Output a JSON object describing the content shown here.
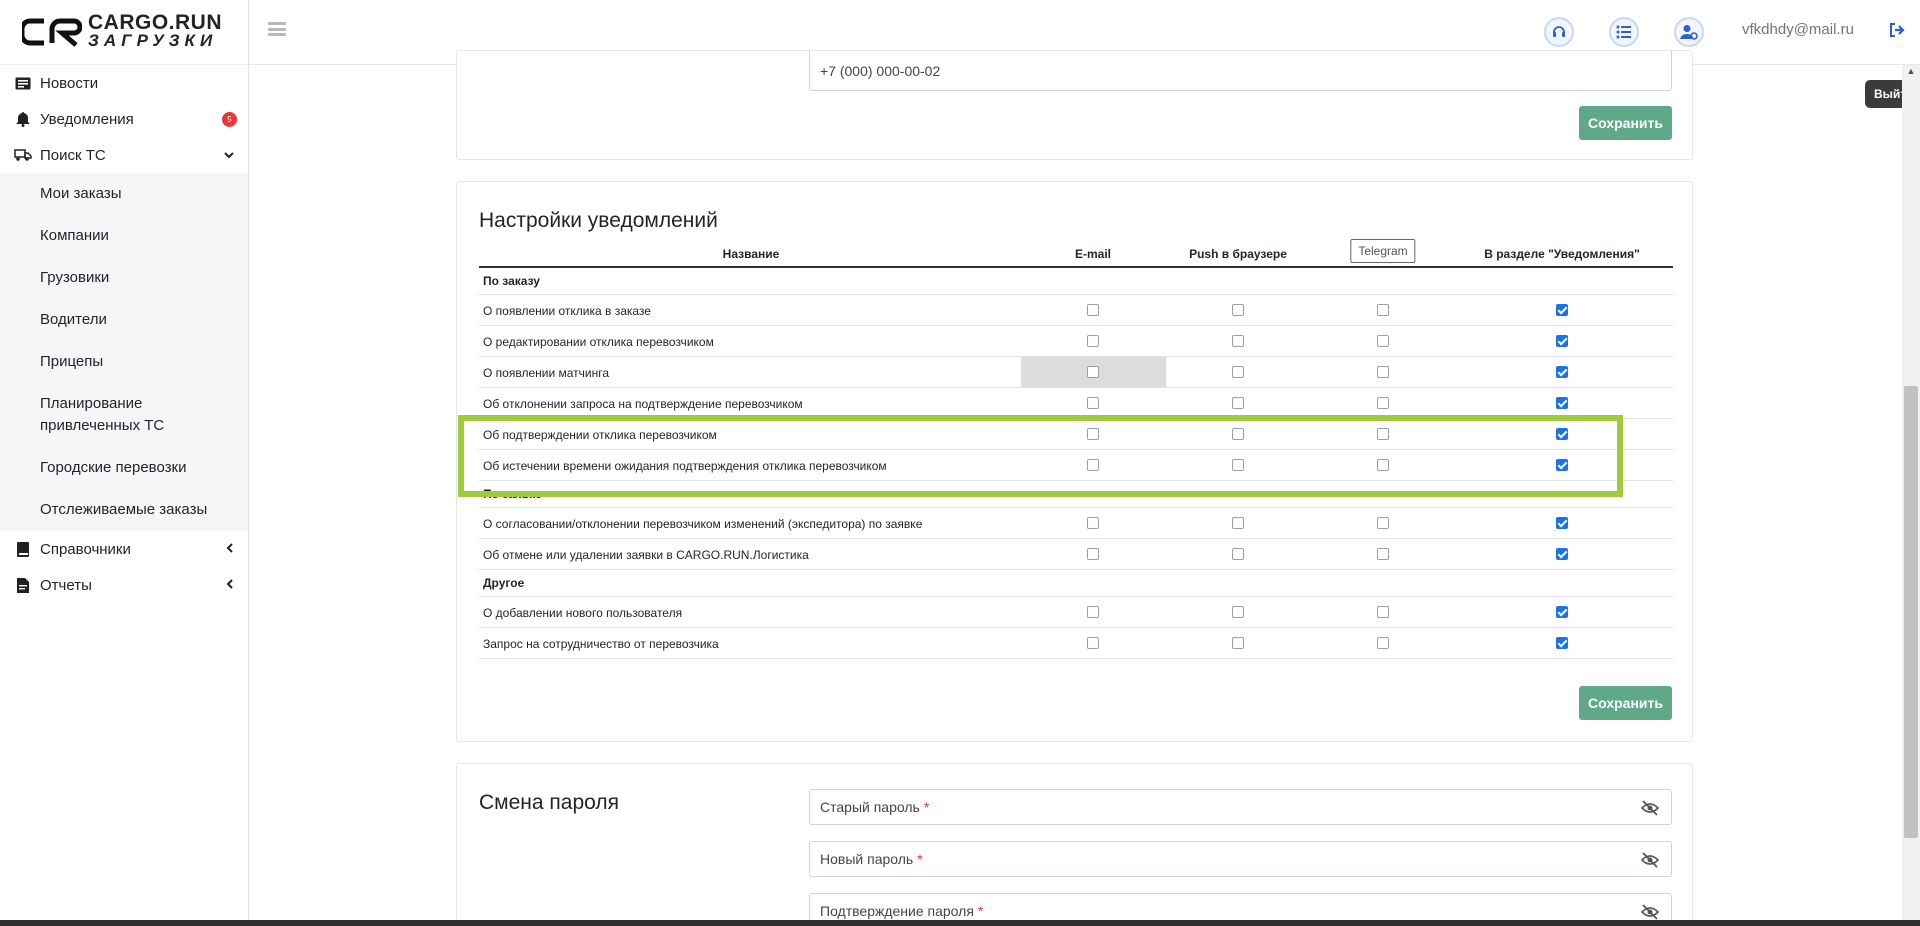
{
  "brand": {
    "line1": "CARGO.RUN",
    "line2": "ЗАГРУЗКИ"
  },
  "sidebar": {
    "items": [
      {
        "label": "Новости",
        "icon": "newspaper-icon"
      },
      {
        "label": "Уведомления",
        "icon": "bell-icon",
        "badge": "5"
      },
      {
        "label": "Поиск ТС",
        "icon": "truck-search-icon",
        "expanded": true
      }
    ],
    "subitems": [
      "Мои заказы",
      "Компании",
      "Грузовики",
      "Водители",
      "Прицепы",
      "Планирование привлеченных ТС",
      "Городские перевозки",
      "Отслеживаемые заказы"
    ],
    "bottom_items": [
      {
        "label": "Справочники",
        "icon": "book-icon"
      },
      {
        "label": "Отчеты",
        "icon": "report-icon"
      }
    ]
  },
  "header": {
    "user_email": "vfkdhdy@mail.ru",
    "icons": [
      "headset-icon",
      "list-icon",
      "user-settings-icon",
      "logout-icon"
    ],
    "tooltip": "Выйти"
  },
  "contact": {
    "phone_value": "+7 (000) 000-00-02",
    "save_label": "Сохранить"
  },
  "notifications": {
    "title": "Настройки уведомлений",
    "columns": {
      "name": "Название",
      "email": "E-mail",
      "push": "Push в браузере",
      "telegram": "Telegram",
      "section": "В разделе \"Уведомления\""
    },
    "groups": [
      {
        "title": "По заказу",
        "rows": [
          {
            "name": "О появлении отклика в заказе",
            "email": false,
            "push": false,
            "telegram": false,
            "section": true
          },
          {
            "name": "О редактировании отклика перевозчиком",
            "email": false,
            "push": false,
            "telegram": false,
            "section": true
          },
          {
            "name": "О появлении матчинга",
            "email": false,
            "push": false,
            "telegram": false,
            "section": true,
            "email_disabled": true
          },
          {
            "name": "Об отклонении запроса на подтверждение перевозчиком",
            "email": false,
            "push": false,
            "telegram": false,
            "section": true
          },
          {
            "name": "Об подтверждении отклика перевозчиком",
            "email": false,
            "push": false,
            "telegram": false,
            "section": true
          },
          {
            "name": "Об истечении времени ожидания подтверждения отклика перевозчиком",
            "email": false,
            "push": false,
            "telegram": false,
            "section": true
          }
        ]
      },
      {
        "title": "По заявке",
        "rows": [
          {
            "name": "О согласовании/отклонении перевозчиком изменений (экспедитора) по заявке",
            "email": false,
            "push": false,
            "telegram": false,
            "section": true
          },
          {
            "name": "Об отмене или удалении заявки в CARGO.RUN.Логистика",
            "email": false,
            "push": false,
            "telegram": false,
            "section": true
          }
        ]
      },
      {
        "title": "Другое",
        "rows": [
          {
            "name": "О добавлении нового пользователя",
            "email": false,
            "push": false,
            "telegram": false,
            "section": true
          },
          {
            "name": "Запрос на сотрудничество от перевозчика",
            "email": false,
            "push": false,
            "telegram": false,
            "section": true
          }
        ]
      }
    ],
    "save_label": "Сохранить"
  },
  "password": {
    "title": "Смена пароля",
    "old_label": "Старый пароль",
    "new_label": "Новый пароль",
    "confirm_label": "Подтверждение пароля",
    "required_mark": "*"
  },
  "colors": {
    "accent_green": "#5fa98a",
    "highlight": "#9ccc3c",
    "checkbox_blue": "#1a73e8",
    "badge_red": "#e53935"
  }
}
